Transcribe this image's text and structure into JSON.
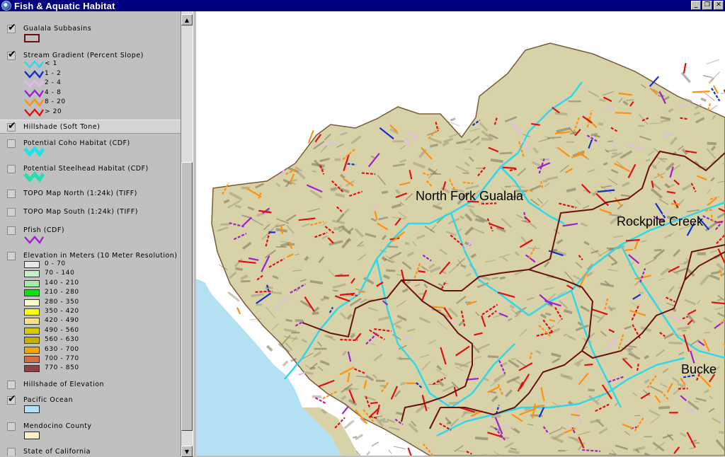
{
  "window": {
    "title": "Fish & Aquatic Habitat",
    "minimize_glyph": "_",
    "restore_glyph": "❐",
    "close_glyph": "✕"
  },
  "toc": {
    "layers": [
      {
        "name": "Gualala Subbasins",
        "checked": true
      },
      {
        "name": "Stream Gradient (Percent Slope)",
        "checked": true
      },
      {
        "name": "Hillshade (Soft Tone)",
        "checked": true,
        "selected": true
      },
      {
        "name": "Potential Coho Habitat (CDF)",
        "checked": false
      },
      {
        "name": "Potential Steelhead Habitat (CDF)",
        "checked": false
      },
      {
        "name": "TOPO Map North (1:24k) (TIFF)",
        "checked": false
      },
      {
        "name": "TOPO Map South (1:24k) (TIFF)",
        "checked": false
      },
      {
        "name": "Pfish (CDF)",
        "checked": false
      },
      {
        "name": "Elevation in Meters (10 Meter Resolution)",
        "checked": false
      },
      {
        "name": "Hillshade of Elevation",
        "checked": false
      },
      {
        "name": "Pacific Ocean",
        "checked": true
      },
      {
        "name": "Mendocino County",
        "checked": false
      },
      {
        "name": "State of California",
        "checked": false
      }
    ],
    "subbasin_swatch": {
      "fill": "#c0c0c0",
      "stroke": "#6b0f0f"
    },
    "gradient_classes": [
      {
        "label": "< 1",
        "color": "#2fd8e8"
      },
      {
        "label": "1 - 2",
        "color": "#1030d0"
      },
      {
        "label": "2 - 4",
        "color": "#e8b8ec"
      },
      {
        "label": "4 - 8",
        "color": "#a020d0"
      },
      {
        "label": "8 - 20",
        "color": "#ff9010"
      },
      {
        "label": "> 20",
        "color": "#e01010"
      }
    ],
    "coho_color": "#20e0e8",
    "steelhead_color": "#20e0b0",
    "pfish_color": "#a020d0",
    "elevation_classes": [
      {
        "label": "0 - 70",
        "color": "#e8e8e8"
      },
      {
        "label": "70 - 140",
        "color": "#c8f0c8"
      },
      {
        "label": "140 - 210",
        "color": "#a8e8a8"
      },
      {
        "label": "210 - 280",
        "color": "#10e010"
      },
      {
        "label": "280 - 350",
        "color": "#fff8c8"
      },
      {
        "label": "350 - 420",
        "color": "#ffff00"
      },
      {
        "label": "420 - 490",
        "color": "#f8e088"
      },
      {
        "label": "490 - 560",
        "color": "#d8c800"
      },
      {
        "label": "560 - 630",
        "color": "#c8b000"
      },
      {
        "label": "630 - 700",
        "color": "#f0a800"
      },
      {
        "label": "700 - 770",
        "color": "#d07040"
      },
      {
        "label": "770 - 850",
        "color": "#904040"
      }
    ],
    "ocean_color": "#b4e0f4",
    "county_color": "#fff0c8"
  },
  "map": {
    "labels": {
      "north_fork": "North Fork Gualala",
      "rockpile": "Rockpile Creek",
      "buckeye": "Bucke"
    },
    "colors": {
      "ocean": "#b4e0f4",
      "land": "#d8d2a8",
      "ridge": "#8a8468",
      "boundary": "#6b1010",
      "outline": "#7a5a3a"
    }
  }
}
